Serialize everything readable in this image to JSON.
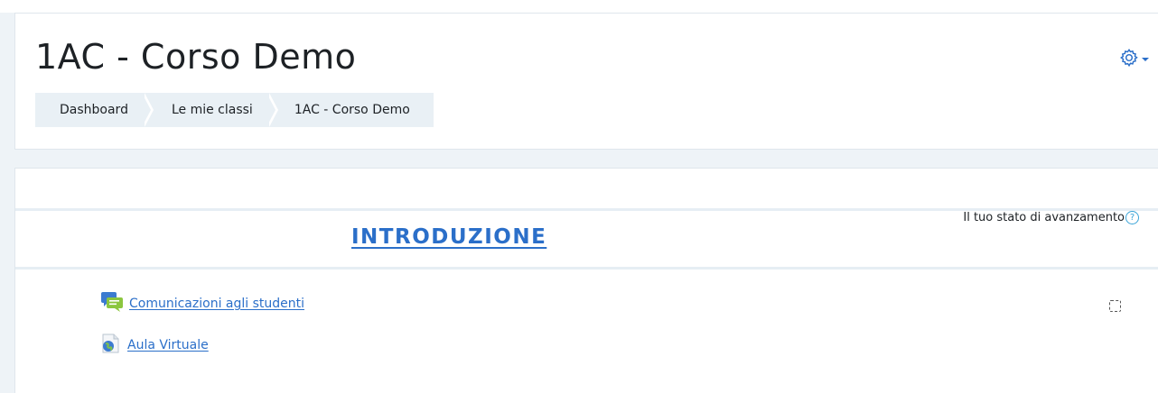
{
  "header": {
    "title": "1AC - Corso Demo",
    "settings_icon": "gear-icon",
    "accent_color": "#2b6fc9"
  },
  "breadcrumb": {
    "items": [
      {
        "label": "Dashboard"
      },
      {
        "label": "Le mie classi"
      },
      {
        "label": "1AC - Corso Demo"
      }
    ]
  },
  "section": {
    "title": "INTRODUZIONE",
    "progress_label": "Il tuo stato di avanzamento",
    "help_glyph": "?"
  },
  "activities": [
    {
      "label": "Comunicazioni agli studenti",
      "icon": "forum-icon",
      "completion": "manual-incomplete"
    },
    {
      "label": "Aula Virtuale",
      "icon": "url-globe-icon"
    }
  ]
}
